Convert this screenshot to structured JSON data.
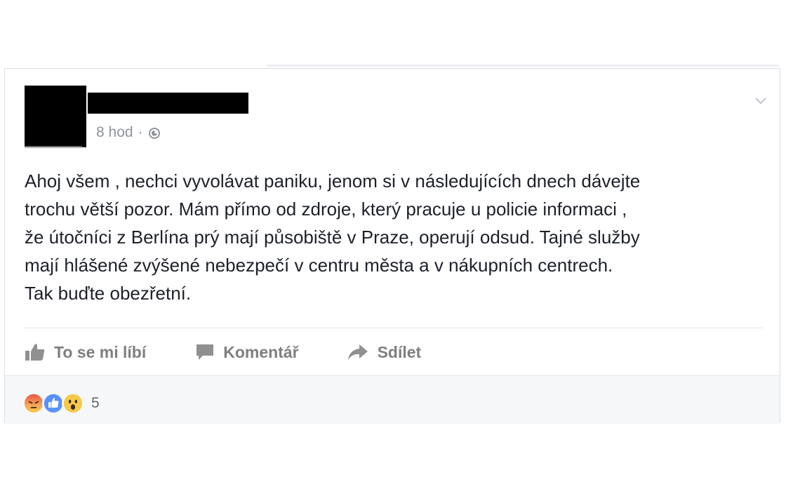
{
  "post": {
    "timestamp": "8 hod",
    "separator": "·",
    "privacy_icon": "globe-icon",
    "options_icon": "chevron-down-icon",
    "text_lines": [
      "Ahoj všem , nechci vyvolávat paniku, jenom si v následujících dnech dávejte",
      "trochu větší pozor. Mám přímo od zdroje, který pracuje u policie informaci ,",
      "že útočníci z Berlína prý mají působiště v Praze, operují odsud. Tajné služby",
      "mají hlášené zvýšené nebezpečí v centru města a v nákupních centrech.",
      "Tak buďte obezřetní."
    ]
  },
  "actions": {
    "like_label": "To se mi líbí",
    "comment_label": "Komentář",
    "share_label": "Sdílet"
  },
  "reactions": {
    "icons": [
      "angry-icon",
      "like-icon",
      "wow-icon"
    ],
    "count": "5"
  },
  "colors": {
    "text": "#1d2129",
    "meta": "#90949c",
    "action": "#7f7f7f",
    "like_blue": "#5890ff",
    "reaction_yellow": "#f7c948",
    "angry_red": "#e9573e"
  }
}
